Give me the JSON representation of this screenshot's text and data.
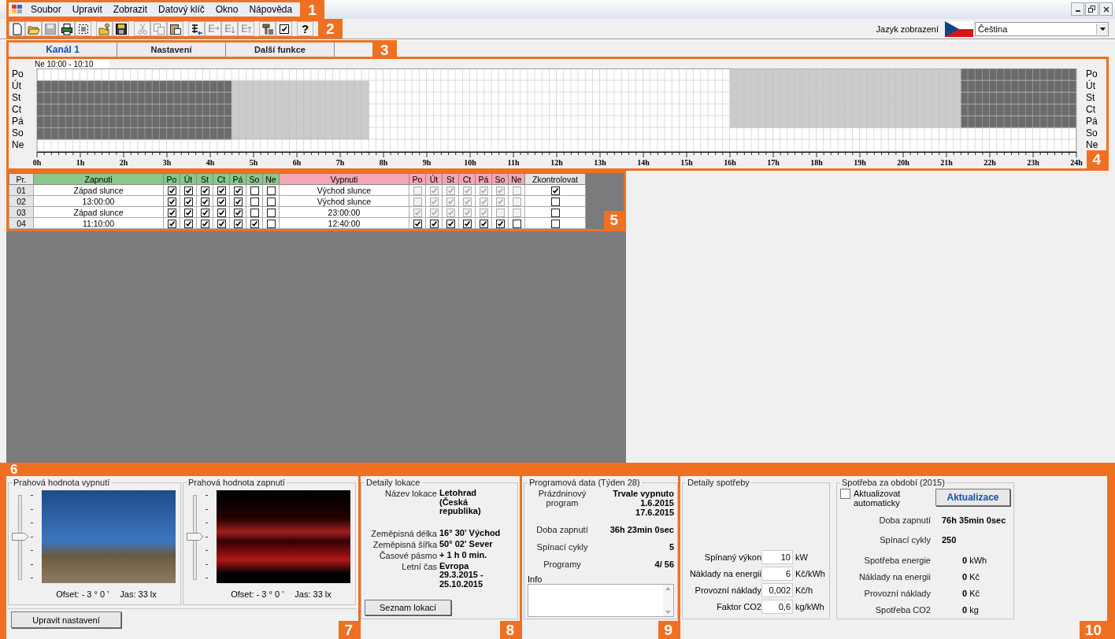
{
  "window": {
    "controls": [
      {
        "kind": "minimize"
      },
      {
        "kind": "restore"
      },
      {
        "kind": "close"
      }
    ]
  },
  "menu": {
    "items": [
      "Soubor",
      "Upravit",
      "Zobrazit",
      "Datový klíč",
      "Okno",
      "Nápověda"
    ]
  },
  "toolbar": {
    "groups": [
      [
        {
          "kind": "new",
          "disabled": false
        },
        {
          "kind": "open",
          "disabled": false
        },
        {
          "kind": "save",
          "disabled": true
        },
        {
          "kind": "print",
          "disabled": false
        },
        {
          "kind": "select",
          "disabled": false
        }
      ],
      [
        {
          "kind": "key-open",
          "disabled": false
        },
        {
          "kind": "key-save",
          "disabled": false
        }
      ],
      [
        {
          "kind": "cut",
          "disabled": true
        },
        {
          "kind": "copy",
          "disabled": true
        },
        {
          "kind": "paste",
          "disabled": false
        }
      ],
      [
        {
          "kind": "lines-insert",
          "disabled": false
        },
        {
          "kind": "lines-right",
          "disabled": true
        },
        {
          "kind": "lines-down",
          "disabled": true
        },
        {
          "kind": "lines-up",
          "disabled": true
        }
      ],
      [
        {
          "kind": "tool",
          "disabled": false
        },
        {
          "kind": "checkbox",
          "disabled": false
        }
      ],
      [
        {
          "kind": "help",
          "disabled": false,
          "glyph": "?"
        }
      ]
    ]
  },
  "language": {
    "label": "Jazyk zobrazení",
    "value": "Čeština"
  },
  "tabs": [
    {
      "label": "Kanál 1",
      "selected": true
    },
    {
      "label": "Nastavení",
      "selected": false
    },
    {
      "label": "Další funkce",
      "selected": false
    }
  ],
  "callouts": [
    "1",
    "2",
    "3",
    "4",
    "5",
    "6",
    "7",
    "8",
    "9",
    "10"
  ],
  "schedule": {
    "tooltip": "Ne 10:00 - 10:10",
    "days_left": [
      "Po",
      "Út",
      "St",
      "Ct",
      "Pá",
      "So",
      "Ne"
    ],
    "days_right": [
      "Po",
      "Út",
      "St",
      "Ct",
      "Pá",
      "So",
      "Ne"
    ],
    "hours": [
      "0h",
      "1h",
      "2h",
      "3h",
      "4h",
      "5h",
      "6h",
      "7h",
      "8h",
      "9h",
      "10h",
      "11h",
      "12h",
      "13h",
      "14h",
      "15h",
      "16h",
      "17h",
      "18h",
      "19h",
      "20h",
      "21h",
      "22h",
      "23h",
      "24h"
    ]
  },
  "table": {
    "columns": [
      {
        "label": "Pr.",
        "kind": "plain"
      },
      {
        "label": "Zapnuti",
        "kind": "on"
      },
      {
        "label": "Po",
        "kind": "on"
      },
      {
        "label": "Út",
        "kind": "on"
      },
      {
        "label": "St",
        "kind": "on"
      },
      {
        "label": "Ct",
        "kind": "on"
      },
      {
        "label": "Pá",
        "kind": "on"
      },
      {
        "label": "So",
        "kind": "on"
      },
      {
        "label": "Ne",
        "kind": "on"
      },
      {
        "label": "Vypnuti",
        "kind": "off"
      },
      {
        "label": "Po",
        "kind": "off"
      },
      {
        "label": "Út",
        "kind": "off"
      },
      {
        "label": "St",
        "kind": "off"
      },
      {
        "label": "Ct",
        "kind": "off"
      },
      {
        "label": "Pá",
        "kind": "off"
      },
      {
        "label": "So",
        "kind": "off"
      },
      {
        "label": "Ne",
        "kind": "off"
      },
      {
        "label": "Zkontrolovat",
        "kind": "plain"
      }
    ],
    "rows": [
      {
        "number": "01",
        "on": "Západ slunce",
        "on_days": [
          {
            "checked": true,
            "disabled": false
          },
          {
            "checked": true,
            "disabled": false
          },
          {
            "checked": true,
            "disabled": false
          },
          {
            "checked": true,
            "disabled": false
          },
          {
            "checked": true,
            "disabled": false
          },
          {
            "checked": false,
            "disabled": false
          },
          {
            "checked": false,
            "disabled": false
          }
        ],
        "off": "Východ slunce",
        "off_days": [
          {
            "checked": false,
            "disabled": true
          },
          {
            "checked": true,
            "disabled": true
          },
          {
            "checked": true,
            "disabled": true
          },
          {
            "checked": true,
            "disabled": true
          },
          {
            "checked": true,
            "disabled": true
          },
          {
            "checked": true,
            "disabled": true
          },
          {
            "checked": false,
            "disabled": true
          }
        ],
        "verify": {
          "checked": true
        }
      },
      {
        "number": "02",
        "on": "13:00:00",
        "on_days": [
          {
            "checked": true,
            "disabled": false
          },
          {
            "checked": true,
            "disabled": false
          },
          {
            "checked": true,
            "disabled": false
          },
          {
            "checked": true,
            "disabled": false
          },
          {
            "checked": true,
            "disabled": false
          },
          {
            "checked": false,
            "disabled": false
          },
          {
            "checked": false,
            "disabled": false
          }
        ],
        "off": "Východ slunce",
        "off_days": [
          {
            "checked": false,
            "disabled": true
          },
          {
            "checked": true,
            "disabled": true
          },
          {
            "checked": true,
            "disabled": true
          },
          {
            "checked": true,
            "disabled": true
          },
          {
            "checked": true,
            "disabled": true
          },
          {
            "checked": true,
            "disabled": true
          },
          {
            "checked": false,
            "disabled": true
          }
        ],
        "verify": {
          "checked": false
        }
      },
      {
        "number": "03",
        "on": "Západ slunce",
        "on_days": [
          {
            "checked": true,
            "disabled": false
          },
          {
            "checked": true,
            "disabled": false
          },
          {
            "checked": true,
            "disabled": false
          },
          {
            "checked": true,
            "disabled": false
          },
          {
            "checked": true,
            "disabled": false
          },
          {
            "checked": false,
            "disabled": false
          },
          {
            "checked": false,
            "disabled": false
          }
        ],
        "off": "23:00:00",
        "off_days": [
          {
            "checked": true,
            "disabled": true
          },
          {
            "checked": true,
            "disabled": true
          },
          {
            "checked": true,
            "disabled": true
          },
          {
            "checked": true,
            "disabled": true
          },
          {
            "checked": true,
            "disabled": true
          },
          {
            "checked": false,
            "disabled": true
          },
          {
            "checked": false,
            "disabled": true
          }
        ],
        "verify": {
          "checked": false
        }
      },
      {
        "number": "04",
        "on": "11:10:00",
        "on_days": [
          {
            "checked": true,
            "disabled": false
          },
          {
            "checked": true,
            "disabled": false
          },
          {
            "checked": true,
            "disabled": false
          },
          {
            "checked": true,
            "disabled": false
          },
          {
            "checked": true,
            "disabled": false
          },
          {
            "checked": true,
            "disabled": false
          },
          {
            "checked": false,
            "disabled": false
          }
        ],
        "off": "12:40:00",
        "off_days": [
          {
            "checked": true,
            "disabled": false
          },
          {
            "checked": true,
            "disabled": false
          },
          {
            "checked": true,
            "disabled": false
          },
          {
            "checked": true,
            "disabled": false
          },
          {
            "checked": true,
            "disabled": false
          },
          {
            "checked": true,
            "disabled": false
          },
          {
            "checked": false,
            "disabled": false
          }
        ],
        "verify": {
          "checked": false
        }
      }
    ]
  },
  "thresholds": {
    "groups": [
      {
        "title": "Prahová hodnota vypnutí",
        "level": 0.5,
        "offset": "Ofset: - 3 ° 0 '",
        "brightness": "Jas: 33 lx"
      },
      {
        "title": "Prahová hodnota zapnutí",
        "level": 0.5,
        "offset": "Ofset: - 3 ° 0 '",
        "brightness": "Jas: 33 lx"
      }
    ],
    "button": "Upravit nastavení"
  },
  "location": {
    "title": "Detaily lokace",
    "rows": [
      {
        "label": "Název lokace",
        "value": "Letohrad\n(Česká\nrepublika)"
      },
      {
        "label": "Zeměpisná délka",
        "value": "16° 30' Východ"
      },
      {
        "label": "Zeměpisná šířka",
        "value": "50° 02' Sever"
      },
      {
        "label": "Časové pásmo",
        "value": "+ 1 h 0 min."
      },
      {
        "label": "Letní čas",
        "value": "Evropa\n29.3.2015 -\n25.10.2015"
      }
    ],
    "button": "Seznam lokací"
  },
  "program": {
    "title": "Programová data (Týden 28)",
    "rows": [
      {
        "label": "Prázdninový program",
        "value": "Trvale vypnuto\n1.6.2015\n17.6.2015"
      },
      {
        "label": "Doba zapnutí",
        "value": "36h 23min 0sec"
      },
      {
        "label": "Spínací cykly",
        "value": "5"
      },
      {
        "label": "Programy",
        "value": "4/ 56"
      }
    ],
    "info_label": "Info"
  },
  "consumption": {
    "title": "Detaily spotřeby",
    "fields": [
      {
        "label": "Spínaný výkon",
        "value": "10",
        "unit": "kW"
      },
      {
        "label": "Náklady na energii",
        "value": "6",
        "unit": "Kč/kWh"
      },
      {
        "label": "Provozní náklady",
        "value": "0,002",
        "unit": "Kč/h"
      },
      {
        "label": "Faktor CO2",
        "value": "0,6",
        "unit": "kg/kWh"
      }
    ]
  },
  "period": {
    "title": "Spotřeba za období (2015)",
    "auto": {
      "label": "Aktualizovat automaticky",
      "checked": false
    },
    "button": "Aktualizace",
    "times": [
      {
        "label": "Doba zapnutí",
        "value": "76h 35min 0sec"
      },
      {
        "label": "Spínací cykly",
        "value": "250"
      }
    ],
    "totals": [
      {
        "label": "Spotřeba energie",
        "value": "0",
        "unit": "kWh"
      },
      {
        "label": "Náklady na energii",
        "value": "0",
        "unit": "Kč"
      },
      {
        "label": "Provozní náklady",
        "value": "0",
        "unit": "Kč"
      },
      {
        "label": "Spotřeba CO2",
        "value": "0",
        "unit": "kg"
      }
    ]
  }
}
